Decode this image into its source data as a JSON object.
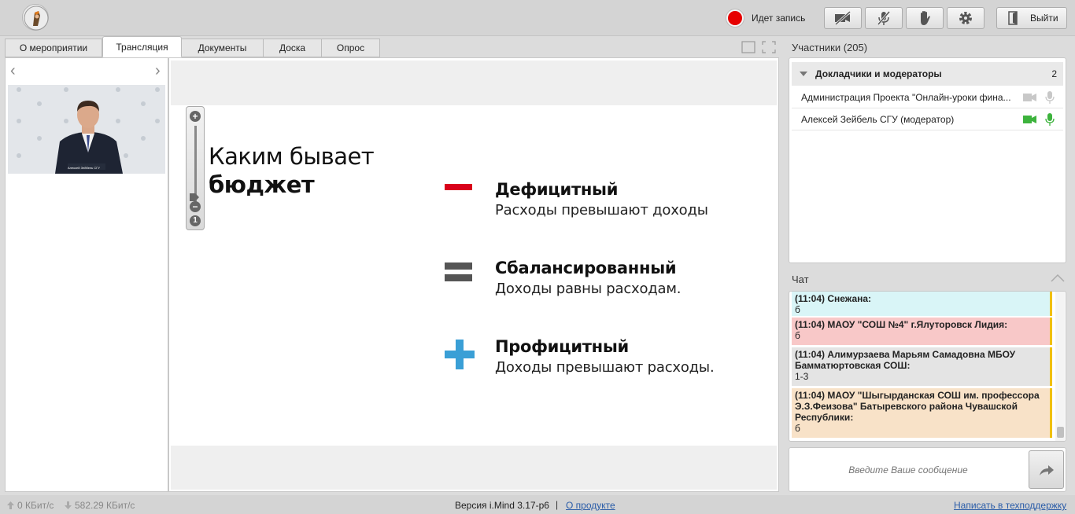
{
  "header": {
    "recording_label": "Идет запись",
    "exit_label": "Выйти",
    "colors": {
      "recording": "#e60000",
      "link": "#2a5ca8"
    },
    "icons": [
      "camera-off-icon",
      "mic-off-icon",
      "hand-icon",
      "gear-icon",
      "exit-door-icon"
    ]
  },
  "tabs": [
    {
      "label": "О мероприятии",
      "active": false
    },
    {
      "label": "Трансляция",
      "active": true
    },
    {
      "label": "Документы",
      "active": false
    },
    {
      "label": "Доска",
      "active": false
    },
    {
      "label": "Опрос",
      "active": false
    }
  ],
  "video": {
    "speaker_caption": "Алексей Зейбель СГУ"
  },
  "slide": {
    "title_line1": "Каким бывает",
    "title_line2": "бюджет",
    "items": [
      {
        "symbol": "minus",
        "heading": "Дефицитный",
        "text": "Расходы превышают доходы",
        "color": "#d9001b"
      },
      {
        "symbol": "equals",
        "heading": "Сбалансированный",
        "text": "Доходы равны расходам.",
        "color": "#555555"
      },
      {
        "symbol": "plus",
        "heading": "Профицитный",
        "text": "Доходы превышают расходы.",
        "color": "#3a9fd6"
      }
    ]
  },
  "zoom": {
    "reset_label": "1"
  },
  "participants": {
    "header": "Участники (205)",
    "group": {
      "label": "Докладчики и модераторы",
      "count": "2"
    },
    "rows": [
      {
        "name": "Администрация Проекта \"Онлайн-уроки фина...",
        "camera_on": false,
        "mic_on": false
      },
      {
        "name": "Алексей Зейбель СГУ (модератор)",
        "camera_on": true,
        "mic_on": true
      }
    ]
  },
  "chat": {
    "header": "Чат",
    "messages": [
      {
        "head": "(11:04) Снежана:",
        "text": "б",
        "bg": "#d9f5f7"
      },
      {
        "head": "(11:04) МАОУ \"СОШ №4\" г.Ялуторовск Лидия:",
        "text": "б",
        "bg": "#f8c8c8"
      },
      {
        "head": "(11:04) Алимурзаева Марьям Самадовна МБОУ Бамматюртовская СОШ:",
        "text": "1-3",
        "bg": "#e4e4e4"
      },
      {
        "head": "(11:04) МАОУ \"Шыгырданская СОШ им. профессора Э.З.Феизова\" Батыревского района Чувашской Республики:",
        "text": "б",
        "bg": "#f8e2c8"
      }
    ],
    "input_placeholder": "Введите Ваше сообщение"
  },
  "footer": {
    "upload_speed": "0 КБит/с",
    "download_speed": "582.29 КБит/с",
    "version": "Версия i.Mind 3.17-р6",
    "separator": "|",
    "about_link": "О продукте",
    "support_link": "Написать в техподдержку"
  }
}
